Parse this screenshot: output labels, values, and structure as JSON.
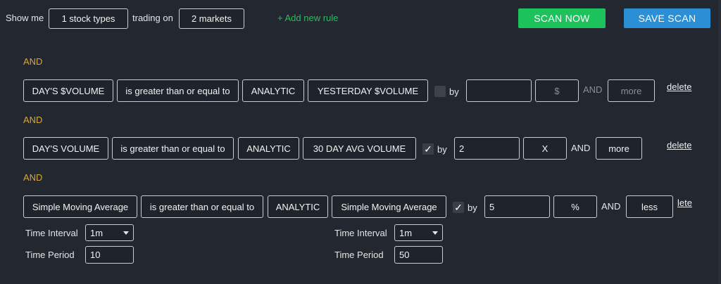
{
  "header": {
    "show_me": "Show me",
    "stock_types": "1 stock types",
    "trading_on": "trading on",
    "markets": "2 markets",
    "add_rule": "+ Add new rule",
    "scan_now": "SCAN NOW",
    "save_scan": "SAVE SCAN"
  },
  "rules": [
    {
      "connector": "AND",
      "field": "DAY'S $VOLUME",
      "operator": "is greater than or equal to",
      "type": "ANALYTIC",
      "compare": "YESTERDAY $VOLUME",
      "by_checked": false,
      "by_label": "by",
      "by_value": "",
      "unit": "$",
      "and_label": "AND",
      "direction": "more",
      "delete": "delete"
    },
    {
      "connector": "AND",
      "field": "DAY'S VOLUME",
      "operator": "is greater than or equal to",
      "type": "ANALYTIC",
      "compare": "30 DAY AVG VOLUME",
      "by_checked": true,
      "by_label": "by",
      "by_value": "2",
      "unit": "X",
      "and_label": "AND",
      "direction": "more",
      "delete": "delete"
    },
    {
      "connector": "AND",
      "field": "Simple Moving Average",
      "operator": "is greater than or equal to",
      "type": "ANALYTIC",
      "compare": "Simple Moving Average",
      "by_checked": true,
      "by_label": "by",
      "by_value": "5",
      "unit": "%",
      "and_label": "AND",
      "direction": "less",
      "delete": "lete",
      "left_params": {
        "interval_label": "Time Interval",
        "interval_value": "1m",
        "period_label": "Time Period",
        "period_value": "10"
      },
      "right_params": {
        "interval_label": "Time Interval",
        "interval_value": "1m",
        "period_label": "Time Period",
        "period_value": "50"
      }
    }
  ],
  "checkmark": "✓",
  "colors": {
    "background": "#222730",
    "connector": "#d9a93a",
    "scan_now": "#1ec25c",
    "save_scan": "#2b8fd6",
    "add_rule": "#25c15a"
  }
}
